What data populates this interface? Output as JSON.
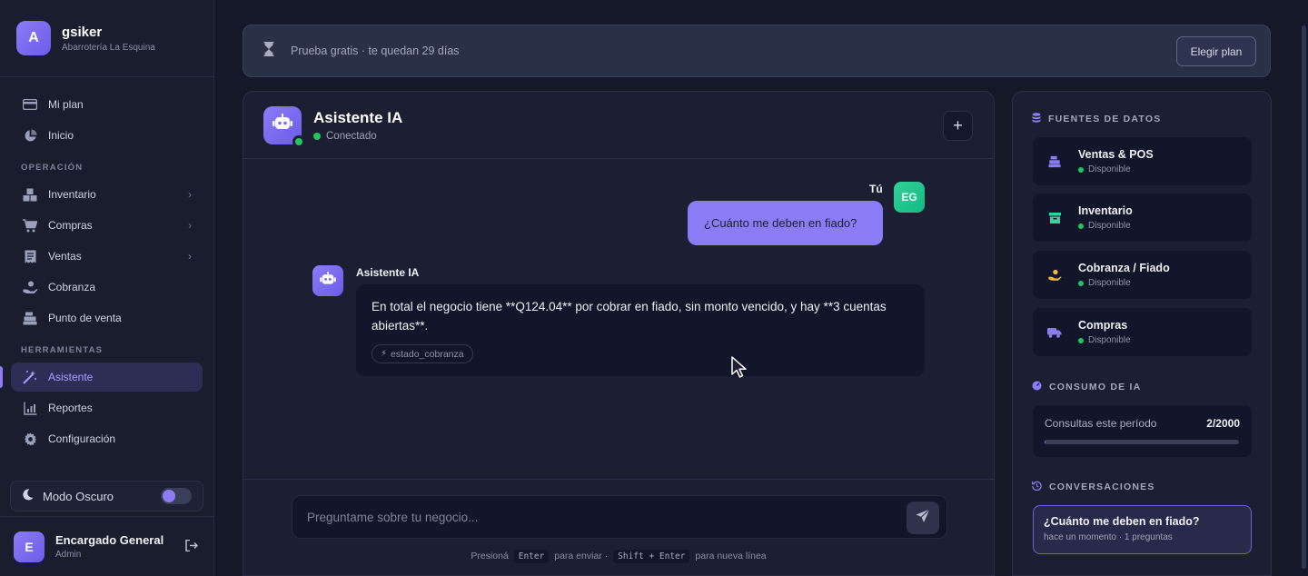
{
  "brand": {
    "initial": "A",
    "name": "gsiker",
    "subtitle": "Abarrotería La Esquina"
  },
  "nav": {
    "top": [
      {
        "label": "Mi plan",
        "icon": "card-icon"
      },
      {
        "label": "Inicio",
        "icon": "pie-chart-icon"
      }
    ],
    "section_operacion": "OPERACIÓN",
    "operacion": [
      {
        "label": "Inventario",
        "icon": "boxes-icon"
      },
      {
        "label": "Compras",
        "icon": "cart-icon"
      },
      {
        "label": "Ventas",
        "icon": "receipt-icon"
      },
      {
        "label": "Cobranza",
        "icon": "hand-coin-icon"
      },
      {
        "label": "Punto de venta",
        "icon": "register-icon"
      }
    ],
    "section_herramientas": "HERRAMIENTAS",
    "herramientas": [
      {
        "label": "Asistente",
        "icon": "magic-wand-icon"
      },
      {
        "label": "Reportes",
        "icon": "bar-chart-icon"
      },
      {
        "label": "Configuración",
        "icon": "gear-icon"
      }
    ]
  },
  "dark_mode": {
    "label": "Modo Oscuro",
    "enabled": true
  },
  "user": {
    "initial": "E",
    "name": "Encargado General",
    "role": "Admin"
  },
  "trial": {
    "text": "Prueba gratis · te quedan 29 días",
    "button": "Elegir plan"
  },
  "chat": {
    "title": "Asistente IA",
    "status": "Conectado",
    "new_button": "+",
    "messages": {
      "user_label": "Tú",
      "user_initials": "EG",
      "user_text": "¿Cuánto me deben en fiado?",
      "bot_label": "Asistente IA",
      "bot_text": "En total el negocio tiene **Q124.04** por cobrar en fiado, sin monto vencido, y hay **3 cuentas abiertas**.",
      "tool_chip": "estado_cobranza"
    },
    "composer": {
      "placeholder": "Preguntame sobre tu negocio...",
      "hint_prefix": "Presioná",
      "hint_key1": "Enter",
      "hint_mid": "para enviar ·",
      "hint_key2": "Shift + Enter",
      "hint_suffix": "para nueva línea"
    }
  },
  "panel": {
    "sources_title": "FUENTES DE DATOS",
    "sources": [
      {
        "name": "Ventas & POS",
        "status": "Disponible",
        "icon": "register-icon",
        "color": "#8b7cf6"
      },
      {
        "name": "Inventario",
        "status": "Disponible",
        "icon": "archive-icon",
        "color": "#34d399"
      },
      {
        "name": "Cobranza / Fiado",
        "status": "Disponible",
        "icon": "hand-coin-icon",
        "color": "#f5b942"
      },
      {
        "name": "Compras",
        "status": "Disponible",
        "icon": "truck-icon",
        "color": "#8b7cf6"
      }
    ],
    "usage_title": "CONSUMO DE IA",
    "usage_label": "Consultas este período",
    "usage_count": "2/2000",
    "usage_fraction": 0.001,
    "conversations_title": "CONVERSACIONES",
    "conversation": {
      "title": "¿Cuánto me deben en fiado?",
      "meta": "hace un momento · 1 preguntas"
    }
  },
  "colors": {
    "accent": "#8b7cf6",
    "success": "#22c55e",
    "background": "#141828"
  }
}
